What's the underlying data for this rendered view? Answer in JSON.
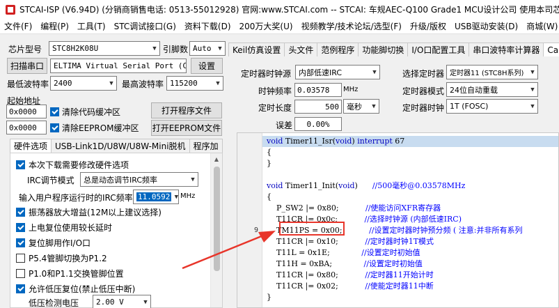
{
  "title": "STCAI-ISP (V6.94D) (分销商销售电话: 0513-55012928) 官网:www.STCAI.com  -- STCAI: 车规AEC-Q100 Grade1 MCU设计公司 使用本司芯片或采购本司芯片的公司",
  "menu": [
    "文件(F)",
    "编程(P)",
    "工具(T)",
    "STC调试接口(G)",
    "资料下载(D)",
    "200万大奖(U)",
    "视频教学/技术论坛/选型(F)",
    "升级/版权",
    "USB驱动安装(D)",
    "商城(W)"
  ],
  "left": {
    "chip_label": "芯片型号",
    "chip_value": "STC8H2K08U",
    "pin_label": "引脚数",
    "pin_value": "Auto",
    "scan_button": "扫描串口",
    "port_value": "ELTIMA Virtual Serial Port (COM",
    "settings_button": "设置",
    "min_baud_label": "最低波特率",
    "min_baud_value": "2400",
    "max_baud_label": "最高波特率",
    "max_baud_value": "115200",
    "start_addr_label": "起始地址",
    "addr1": "0x0000",
    "clear_code_label": "清除代码缓冲区",
    "open_program_button": "打开程序文件",
    "addr2": "0x0000",
    "clear_eeprom_label": "清除EEPROM缓冲区",
    "open_eeprom_button": "打开EEPROM文件",
    "tabs": [
      "硬件选项",
      "USB-Link1D/U8W/U8W-Mini脱机",
      "程序加"
    ],
    "hw": {
      "opt1": "本次下载需要修改硬件选项",
      "irc_mode_label": "IRC调节模式",
      "irc_mode_value": "总是动态调节IRC频率",
      "freq_label": "输入用户程序运行时的IRC频率",
      "freq_value": "11.0592",
      "freq_unit": "MHz",
      "opt2": "振荡器放大增益(12M以上建议选择)",
      "opt3": "上电复位使用较长延时",
      "opt4": "复位脚用作I/O口",
      "opt5": "P5.4管脚切换为P1.2",
      "opt6": "P1.0和P1.1交换管脚位置",
      "opt7": "允许低压复位(禁止低压中断)",
      "lvd_label": "低压检测电压",
      "lvd_value": "2.00 V"
    }
  },
  "right": {
    "tabs": [
      "Keil仿真设置",
      "头文件",
      "范例程序",
      "功能脚切换",
      "I/O口配置工具",
      "串口波特率计算器",
      "Ca"
    ],
    "timer_clk_src_label": "定时器时钟源",
    "timer_clk_src_value": "内部低速IRC",
    "select_timer_label": "选择定时器",
    "select_timer_value": "定时器11 (STC8H系列)",
    "clk_freq_label": "时钟频率",
    "clk_freq_value": "0.03578",
    "clk_freq_unit": "MHz",
    "timer_mode_label": "定时器模式",
    "timer_mode_value": "24位自动重载",
    "timer_len_label": "定时长度",
    "timer_len_value": "500",
    "timer_len_unit": "毫秒",
    "timer_clock_label": "定时器时钟",
    "timer_clock_value": "1T  (FOSC)",
    "error_label": "误差",
    "error_value": "0.00%",
    "code": [
      {
        "ln": "",
        "t": "void Timer11_Isr(void) interrupt 67"
      },
      {
        "ln": "",
        "t": "{"
      },
      {
        "ln": "",
        "t": "}"
      },
      {
        "ln": "",
        "t": ""
      },
      {
        "ln": "",
        "t": "void Timer11_Init(void)      //500毫秒@0.03578MHz"
      },
      {
        "ln": "",
        "t": "{"
      },
      {
        "ln": "",
        "t": "    P_SW2 |= 0x80;           //使能访问XFR寄存器"
      },
      {
        "ln": "",
        "t": "    T11CR |= 0x0c;           //选择时钟源 (内部低速IRC)"
      },
      {
        "ln": "9",
        "t": "    TM11PS = 0x00;           //设置定时器时钟预分频 ( 注意:并非所有系列"
      },
      {
        "ln": "",
        "t": "    T11CR |= 0x10;           //定时器时钟1T模式"
      },
      {
        "ln": "",
        "t": "    T11L = 0x1E;             //设置定时初始值"
      },
      {
        "ln": "",
        "t": "    T11H = 0xBA;             //设置定时初始值"
      },
      {
        "ln": "",
        "t": "    T11CR |= 0x80;           //定时器11开始计时"
      },
      {
        "ln": "",
        "t": "    T11CR |= 0x02;           //使能定时器11中断"
      },
      {
        "ln": "",
        "t": "}"
      }
    ]
  },
  "colors": {
    "accent": "#0067c0",
    "annotation": "#e8352a",
    "highlight": "#c8dcf0"
  }
}
